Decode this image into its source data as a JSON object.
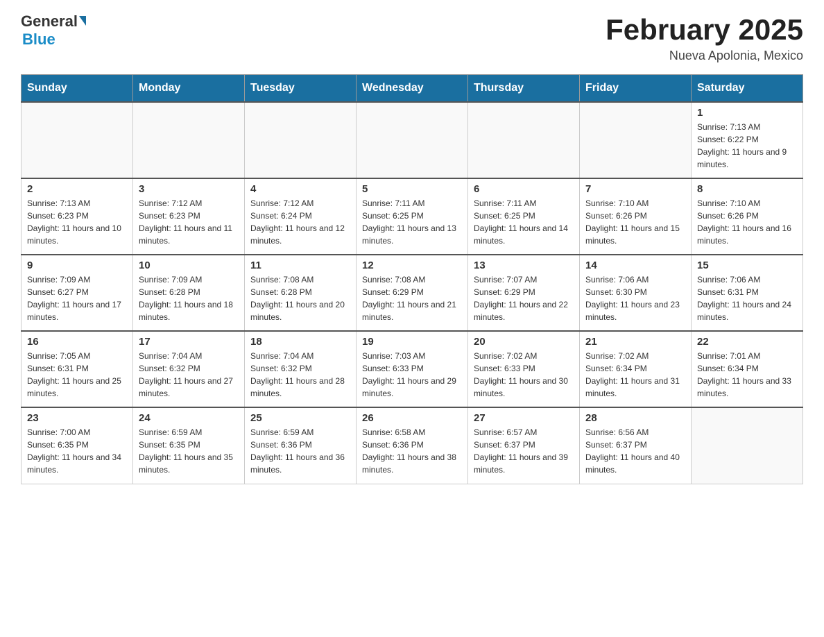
{
  "header": {
    "logo": {
      "general": "General",
      "blue": "Blue"
    },
    "title": "February 2025",
    "location": "Nueva Apolonia, Mexico"
  },
  "days_of_week": [
    "Sunday",
    "Monday",
    "Tuesday",
    "Wednesday",
    "Thursday",
    "Friday",
    "Saturday"
  ],
  "weeks": [
    [
      {
        "day": "",
        "info": "",
        "empty": true
      },
      {
        "day": "",
        "info": "",
        "empty": true
      },
      {
        "day": "",
        "info": "",
        "empty": true
      },
      {
        "day": "",
        "info": "",
        "empty": true
      },
      {
        "day": "",
        "info": "",
        "empty": true
      },
      {
        "day": "",
        "info": "",
        "empty": true
      },
      {
        "day": "1",
        "info": "Sunrise: 7:13 AM\nSunset: 6:22 PM\nDaylight: 11 hours and 9 minutes.",
        "empty": false
      }
    ],
    [
      {
        "day": "2",
        "info": "Sunrise: 7:13 AM\nSunset: 6:23 PM\nDaylight: 11 hours and 10 minutes.",
        "empty": false
      },
      {
        "day": "3",
        "info": "Sunrise: 7:12 AM\nSunset: 6:23 PM\nDaylight: 11 hours and 11 minutes.",
        "empty": false
      },
      {
        "day": "4",
        "info": "Sunrise: 7:12 AM\nSunset: 6:24 PM\nDaylight: 11 hours and 12 minutes.",
        "empty": false
      },
      {
        "day": "5",
        "info": "Sunrise: 7:11 AM\nSunset: 6:25 PM\nDaylight: 11 hours and 13 minutes.",
        "empty": false
      },
      {
        "day": "6",
        "info": "Sunrise: 7:11 AM\nSunset: 6:25 PM\nDaylight: 11 hours and 14 minutes.",
        "empty": false
      },
      {
        "day": "7",
        "info": "Sunrise: 7:10 AM\nSunset: 6:26 PM\nDaylight: 11 hours and 15 minutes.",
        "empty": false
      },
      {
        "day": "8",
        "info": "Sunrise: 7:10 AM\nSunset: 6:26 PM\nDaylight: 11 hours and 16 minutes.",
        "empty": false
      }
    ],
    [
      {
        "day": "9",
        "info": "Sunrise: 7:09 AM\nSunset: 6:27 PM\nDaylight: 11 hours and 17 minutes.",
        "empty": false
      },
      {
        "day": "10",
        "info": "Sunrise: 7:09 AM\nSunset: 6:28 PM\nDaylight: 11 hours and 18 minutes.",
        "empty": false
      },
      {
        "day": "11",
        "info": "Sunrise: 7:08 AM\nSunset: 6:28 PM\nDaylight: 11 hours and 20 minutes.",
        "empty": false
      },
      {
        "day": "12",
        "info": "Sunrise: 7:08 AM\nSunset: 6:29 PM\nDaylight: 11 hours and 21 minutes.",
        "empty": false
      },
      {
        "day": "13",
        "info": "Sunrise: 7:07 AM\nSunset: 6:29 PM\nDaylight: 11 hours and 22 minutes.",
        "empty": false
      },
      {
        "day": "14",
        "info": "Sunrise: 7:06 AM\nSunset: 6:30 PM\nDaylight: 11 hours and 23 minutes.",
        "empty": false
      },
      {
        "day": "15",
        "info": "Sunrise: 7:06 AM\nSunset: 6:31 PM\nDaylight: 11 hours and 24 minutes.",
        "empty": false
      }
    ],
    [
      {
        "day": "16",
        "info": "Sunrise: 7:05 AM\nSunset: 6:31 PM\nDaylight: 11 hours and 25 minutes.",
        "empty": false
      },
      {
        "day": "17",
        "info": "Sunrise: 7:04 AM\nSunset: 6:32 PM\nDaylight: 11 hours and 27 minutes.",
        "empty": false
      },
      {
        "day": "18",
        "info": "Sunrise: 7:04 AM\nSunset: 6:32 PM\nDaylight: 11 hours and 28 minutes.",
        "empty": false
      },
      {
        "day": "19",
        "info": "Sunrise: 7:03 AM\nSunset: 6:33 PM\nDaylight: 11 hours and 29 minutes.",
        "empty": false
      },
      {
        "day": "20",
        "info": "Sunrise: 7:02 AM\nSunset: 6:33 PM\nDaylight: 11 hours and 30 minutes.",
        "empty": false
      },
      {
        "day": "21",
        "info": "Sunrise: 7:02 AM\nSunset: 6:34 PM\nDaylight: 11 hours and 31 minutes.",
        "empty": false
      },
      {
        "day": "22",
        "info": "Sunrise: 7:01 AM\nSunset: 6:34 PM\nDaylight: 11 hours and 33 minutes.",
        "empty": false
      }
    ],
    [
      {
        "day": "23",
        "info": "Sunrise: 7:00 AM\nSunset: 6:35 PM\nDaylight: 11 hours and 34 minutes.",
        "empty": false
      },
      {
        "day": "24",
        "info": "Sunrise: 6:59 AM\nSunset: 6:35 PM\nDaylight: 11 hours and 35 minutes.",
        "empty": false
      },
      {
        "day": "25",
        "info": "Sunrise: 6:59 AM\nSunset: 6:36 PM\nDaylight: 11 hours and 36 minutes.",
        "empty": false
      },
      {
        "day": "26",
        "info": "Sunrise: 6:58 AM\nSunset: 6:36 PM\nDaylight: 11 hours and 38 minutes.",
        "empty": false
      },
      {
        "day": "27",
        "info": "Sunrise: 6:57 AM\nSunset: 6:37 PM\nDaylight: 11 hours and 39 minutes.",
        "empty": false
      },
      {
        "day": "28",
        "info": "Sunrise: 6:56 AM\nSunset: 6:37 PM\nDaylight: 11 hours and 40 minutes.",
        "empty": false
      },
      {
        "day": "",
        "info": "",
        "empty": true
      }
    ]
  ]
}
